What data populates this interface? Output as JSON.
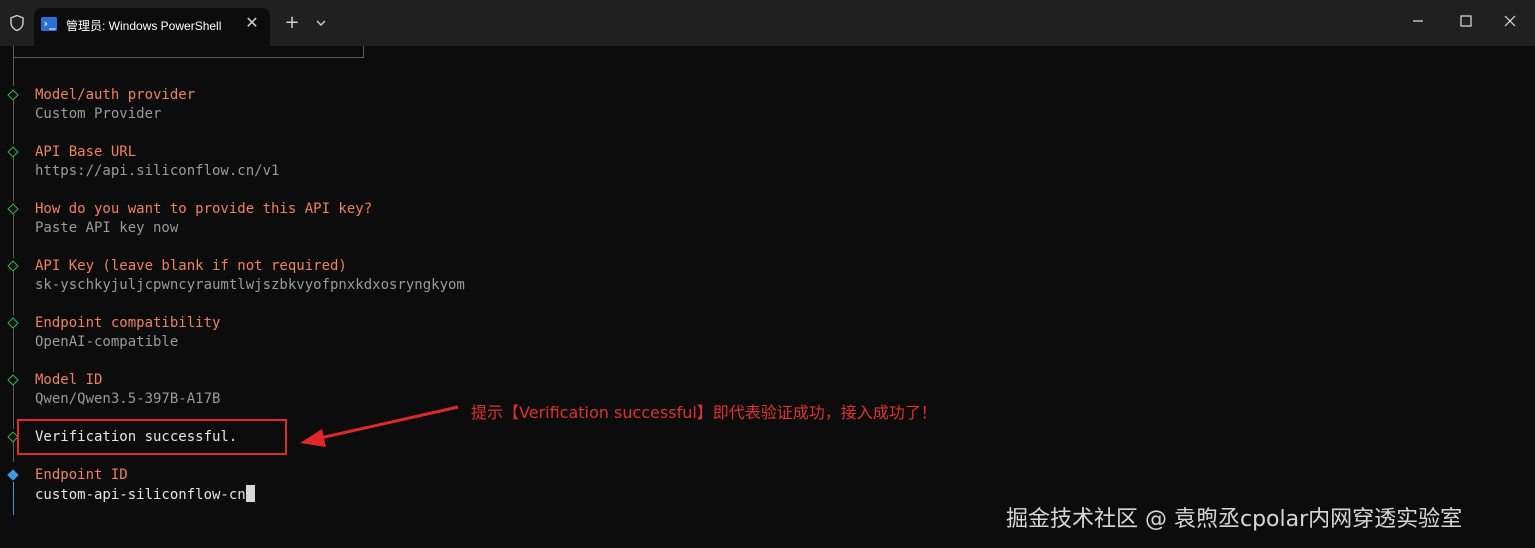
{
  "window": {
    "tab_title": "管理员: Windows PowerShell",
    "tab_icon": "powershell-icon",
    "shield_icon": "shield-icon"
  },
  "terminal": {
    "sections": [
      {
        "label": "Model/auth provider",
        "value": "Custom Provider"
      },
      {
        "label": "API Base URL",
        "value": "https://api.siliconflow.cn/v1"
      },
      {
        "label": "How do you want to provide this API key?",
        "value": "Paste API key now"
      },
      {
        "label": "API Key (leave blank if not required)",
        "value": "sk-yschkyjuljcpwncyraumtlwjszbkvyofpnxkdxosryngkyom"
      },
      {
        "label": "Endpoint compatibility",
        "value": "OpenAI-compatible"
      },
      {
        "label": "Model ID",
        "value": "Qwen/Qwen3.5-397B-A17B"
      }
    ],
    "status": "Verification successful.",
    "prompt": {
      "label": "Endpoint ID",
      "value": "custom-api-siliconflow-cn"
    }
  },
  "annotation": {
    "text": "提示【Verification successful】即代表验证成功，接入成功了！",
    "color": "#e03030"
  },
  "watermark": "掘金技术社区 @ 袁煦丞cpolar内网穿透实验室",
  "colors": {
    "label": "#f0805e",
    "value": "#9a9a9a",
    "diamond_done": "#2fbf4a",
    "diamond_active": "#3b9ae0",
    "background": "#0c0c0c"
  }
}
